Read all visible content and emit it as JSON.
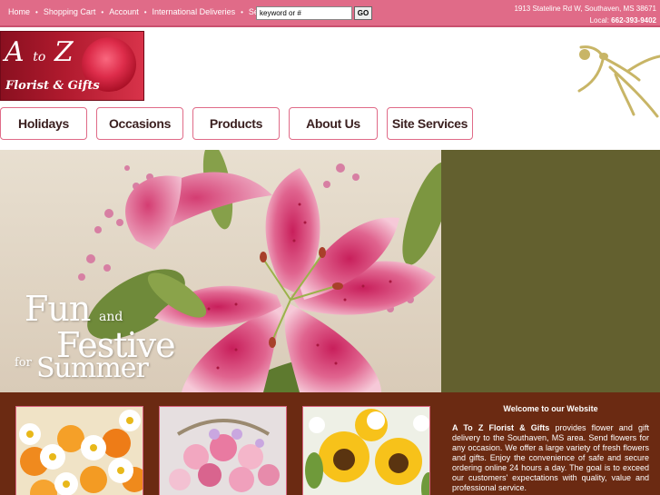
{
  "topbar": {
    "nav": [
      "Home",
      "Shopping Cart",
      "Account",
      "International Deliveries",
      "Search"
    ],
    "search_value": "keyword or #",
    "go_label": "GO",
    "address": "1913 Stateline Rd W, Southaven, MS 38671",
    "local_label": "Local:",
    "phone": "662-393-9402"
  },
  "logo": {
    "line1_a": "A",
    "line1_to": "to",
    "line1_z": "Z",
    "line2": "Florist & Gifts"
  },
  "nav": [
    {
      "label": "Holidays"
    },
    {
      "label": "Occasions"
    },
    {
      "label": "Products"
    },
    {
      "label": "About Us"
    },
    {
      "label": "Site Services"
    }
  ],
  "hero": {
    "fun": "Fun",
    "and": "and",
    "festive": "Festive",
    "for": "for",
    "summer": "Summer"
  },
  "welcome": {
    "title": "Welcome to our Website",
    "brand": "A To Z Florist & Gifts",
    "text": " provides flower and gift delivery to the Southaven, MS area. Send flowers for any occasion. We offer a large variety of fresh flowers and gifts. Enjoy the convenience of safe and secure ordering online 24 hours a day. The goal is to exceed our customers' expectations with quality, value and professional service."
  },
  "colors": {
    "topbar": "#e06b88",
    "hero_side": "#63602f",
    "bottom": "#6b2a12"
  }
}
